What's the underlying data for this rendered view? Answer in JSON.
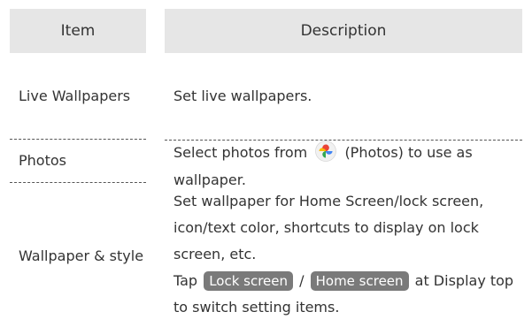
{
  "header": {
    "item": "Item",
    "description": "Description"
  },
  "rows": [
    {
      "item": "Live Wallpapers",
      "description": "Set live wallpapers."
    },
    {
      "item": "Photos",
      "description_before": "Select photos from",
      "icon": "photos-icon",
      "description_after": "(Photos) to use as wallpaper."
    },
    {
      "item": "Wallpaper & style",
      "description_main": "Set wallpaper for Home Screen/lock screen, icon/text color, shortcuts to display on lock screen, etc.",
      "tap_prefix": "Tap",
      "key1": "Lock screen",
      "separator": "/",
      "key2": "Home screen",
      "tap_suffix": "at Display top to switch setting items."
    }
  ],
  "colors": {
    "header_bg": "#e6e6e6",
    "key_bg": "#7a7a7a",
    "text": "#333333"
  }
}
